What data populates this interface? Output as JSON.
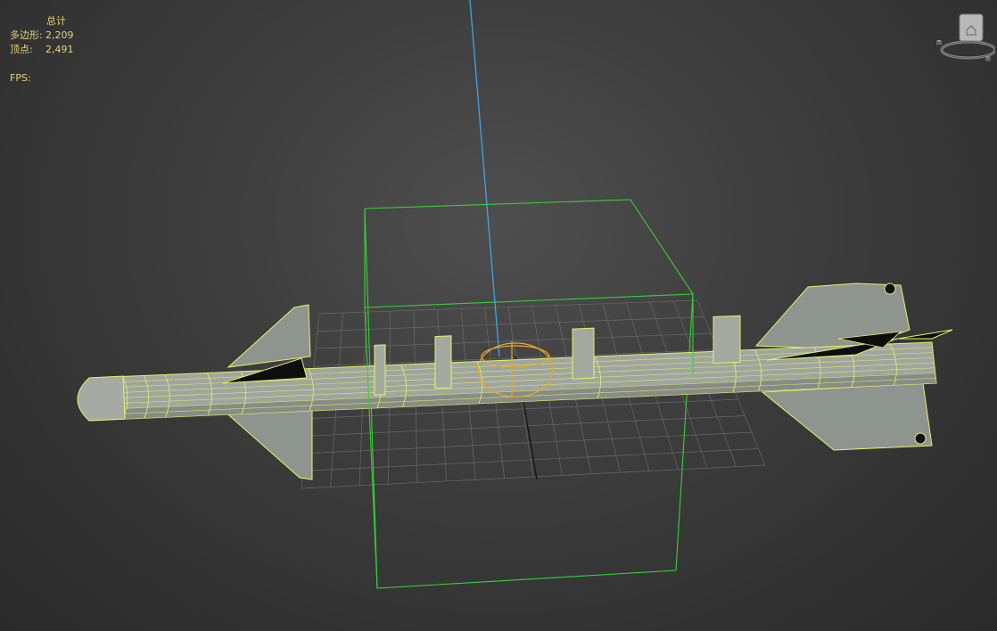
{
  "stats": {
    "header": "总计",
    "polygons_label": "多边形:",
    "polygons_value": "2,209",
    "vertices_label": "顶点:",
    "vertices_value": "2,491",
    "fps_label": "FPS:"
  },
  "viewcube": {
    "label": "viewcube",
    "face_icon": "home-icon",
    "compass_letters": [
      "西",
      "南"
    ]
  },
  "scene": {
    "object": "missile",
    "object_color": "#9aa09a",
    "wire_color": "#e4f26a",
    "bbox_color": "#36d236",
    "z_axis_color": "#3fa4e8",
    "grid_color": "#777777"
  }
}
